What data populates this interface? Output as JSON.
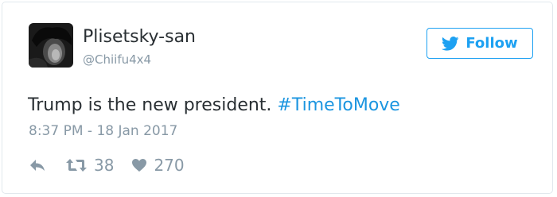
{
  "user": {
    "name": "Plisetsky-san",
    "handle": "@Chiifu4x4"
  },
  "follow_button": {
    "label": "Follow",
    "icon": "twitter-bird-icon"
  },
  "tweet": {
    "text": "Trump is the new president. ",
    "hashtag": "#TimeToMove",
    "timestamp": "8:37 PM - 18 Jan 2017"
  },
  "actions": {
    "reply_icon": "reply-icon",
    "retweet_icon": "retweet-icon",
    "retweet_count": "38",
    "like_icon": "heart-icon",
    "like_count": "270"
  },
  "colors": {
    "accent": "#1da1f2",
    "hashtag": "#1b95e0",
    "text": "#292f33",
    "muted": "#8899a6",
    "border": "#e1e8ed"
  }
}
